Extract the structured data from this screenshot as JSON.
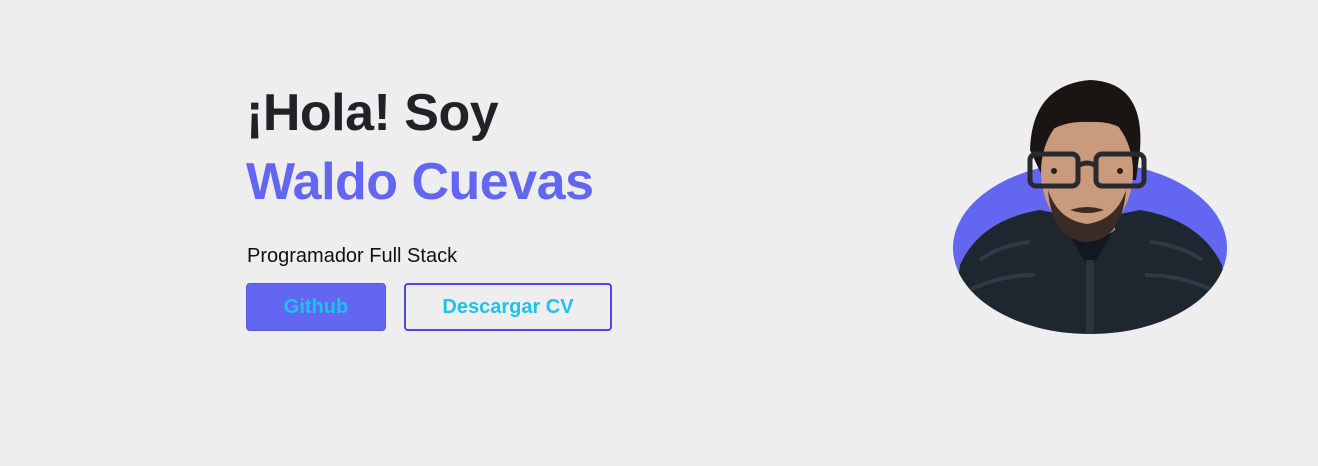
{
  "hero": {
    "greeting": "¡Hola! Soy",
    "name": "Waldo Cuevas",
    "role": "Programador Full Stack",
    "buttons": {
      "github_label": "Github",
      "cv_label": "Descargar CV"
    }
  },
  "colors": {
    "background": "#eeeeee",
    "accent": "#6366f1",
    "button_text": "#1cc3ea",
    "heading": "#1f2226"
  },
  "avatar": {
    "icon": "profile-photo"
  }
}
